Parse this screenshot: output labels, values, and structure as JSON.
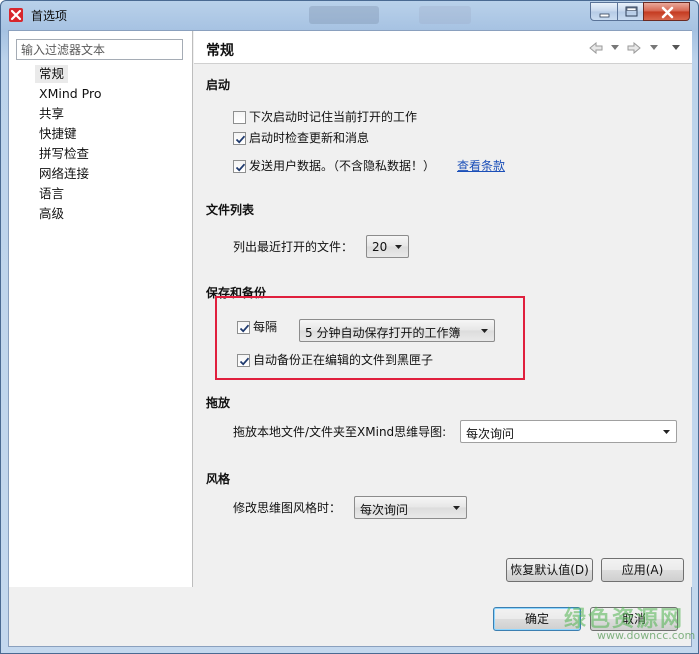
{
  "window": {
    "title": "首选项",
    "controls": {
      "minimize_icon": "minimize-icon",
      "maximize_icon": "maximize-icon",
      "close_icon": "close-icon"
    }
  },
  "sidebar": {
    "filter_placeholder": "输入过滤器文本",
    "items": [
      {
        "label": "常规",
        "selected": true
      },
      {
        "label": "XMind Pro",
        "selected": false
      },
      {
        "label": "共享",
        "selected": false
      },
      {
        "label": "快捷键",
        "selected": false
      },
      {
        "label": "拼写检查",
        "selected": false
      },
      {
        "label": "网络连接",
        "selected": false
      },
      {
        "label": "语言",
        "selected": false
      },
      {
        "label": "高级",
        "selected": false
      }
    ]
  },
  "page": {
    "title": "常规",
    "nav_icons": [
      "back-arrow-icon",
      "forward-arrow-icon"
    ]
  },
  "startup": {
    "title": "启动",
    "remember_open": {
      "label": "下次启动时记住当前打开的工作",
      "checked": false
    },
    "check_updates": {
      "label": "启动时检查更新和消息",
      "checked": true
    },
    "send_data": {
      "label": "发送用户数据。（不含隐私数据！）",
      "checked": true
    },
    "terms_link": "查看条款"
  },
  "file_list": {
    "title": "文件列表",
    "recent_label": "列出最近打开的文件：",
    "recent_value": "20"
  },
  "save_backup": {
    "title": "保存和备份",
    "every": {
      "label": "每隔",
      "checked": true
    },
    "interval_value": "5 分钟自动保存打开的工作簿",
    "auto_backup": {
      "label": "自动备份正在编辑的文件到黑匣子",
      "checked": true
    }
  },
  "drag_drop": {
    "title": "拖放",
    "label": "拖放本地文件/文件夹至XMind思维导图:",
    "value": "每次询问"
  },
  "style": {
    "title": "风格",
    "label": "修改思维图风格时：",
    "value": "每次询问"
  },
  "buttons": {
    "restore_defaults": "恢复默认值(D)",
    "apply": "应用(A)",
    "ok": "确定",
    "cancel": "取消"
  },
  "watermark": {
    "logo": "绿色资源网",
    "url": "www.downcc.com"
  },
  "colors": {
    "highlight": "#e01f3d",
    "link": "#1b4fb8",
    "app_icon": "#d8262c"
  }
}
